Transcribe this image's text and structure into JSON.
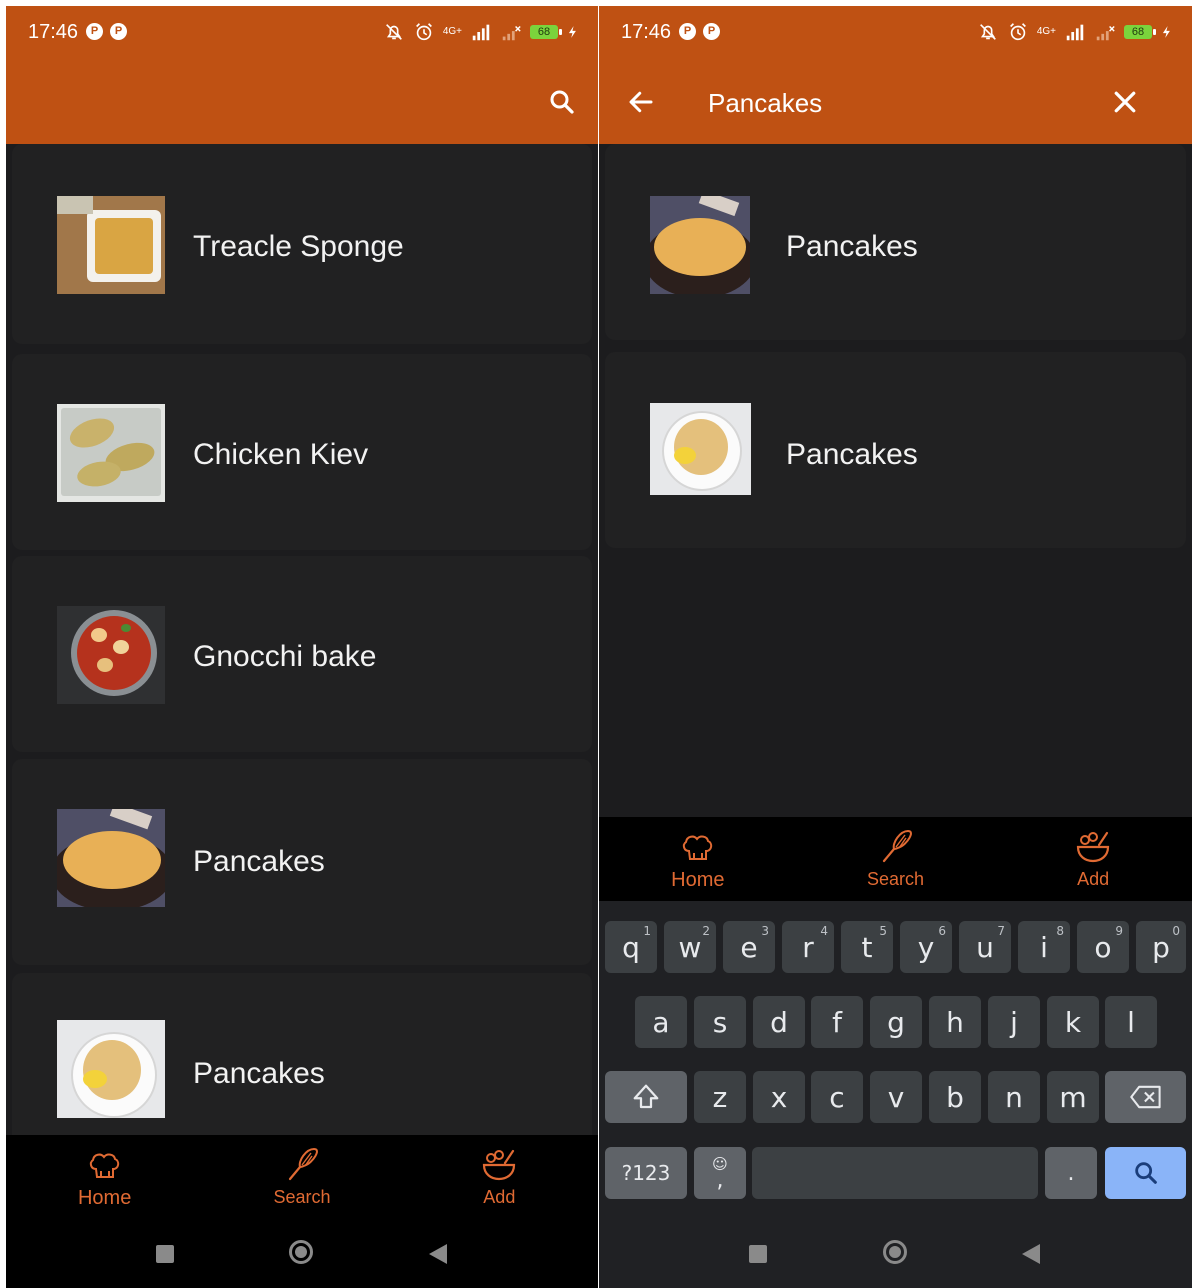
{
  "status_bar": {
    "time": "17:46",
    "network": "4G+",
    "battery": "68"
  },
  "left_screen": {
    "recipes": [
      {
        "name": "Treacle Sponge",
        "image": "treacle-sponge-thumbnail"
      },
      {
        "name": "Chicken Kiev",
        "image": "chicken-kiev-thumbnail"
      },
      {
        "name": "Gnocchi bake",
        "image": "gnocchi-bake-thumbnail"
      },
      {
        "name": "Pancakes",
        "image": "pancakes-thumbnail"
      },
      {
        "name": "Pancakes",
        "image": "pancakes-thumbnail"
      }
    ]
  },
  "right_screen": {
    "search_query": "Pancakes",
    "results": [
      {
        "name": "Pancakes",
        "image": "pancakes-thumbnail"
      },
      {
        "name": "Pancakes",
        "image": "pancakes-thumbnail"
      }
    ]
  },
  "bottom_nav": {
    "home": "Home",
    "search": "Search",
    "add": "Add"
  },
  "keyboard": {
    "row1": [
      "q",
      "w",
      "e",
      "r",
      "t",
      "y",
      "u",
      "i",
      "o",
      "p"
    ],
    "row1_hints": [
      "1",
      "2",
      "3",
      "4",
      "5",
      "6",
      "7",
      "8",
      "9",
      "0"
    ],
    "row2": [
      "a",
      "s",
      "d",
      "f",
      "g",
      "h",
      "j",
      "k",
      "l"
    ],
    "row3": [
      "z",
      "x",
      "c",
      "v",
      "b",
      "n",
      "m"
    ],
    "symbols_key": "?123",
    "comma_key": ",",
    "period_key": "."
  },
  "colors": {
    "accent": "#bf5113",
    "nav_active": "#e06a33",
    "background": "#1c1c1e",
    "card": "#212122",
    "keyboard_search": "#8ab4f8"
  },
  "icons": {
    "app_search": "search-icon",
    "back": "arrow-back-icon",
    "clear": "close-icon",
    "home": "chef-hat-icon",
    "search_nav": "whisk-icon",
    "add": "salad-bowl-icon"
  }
}
